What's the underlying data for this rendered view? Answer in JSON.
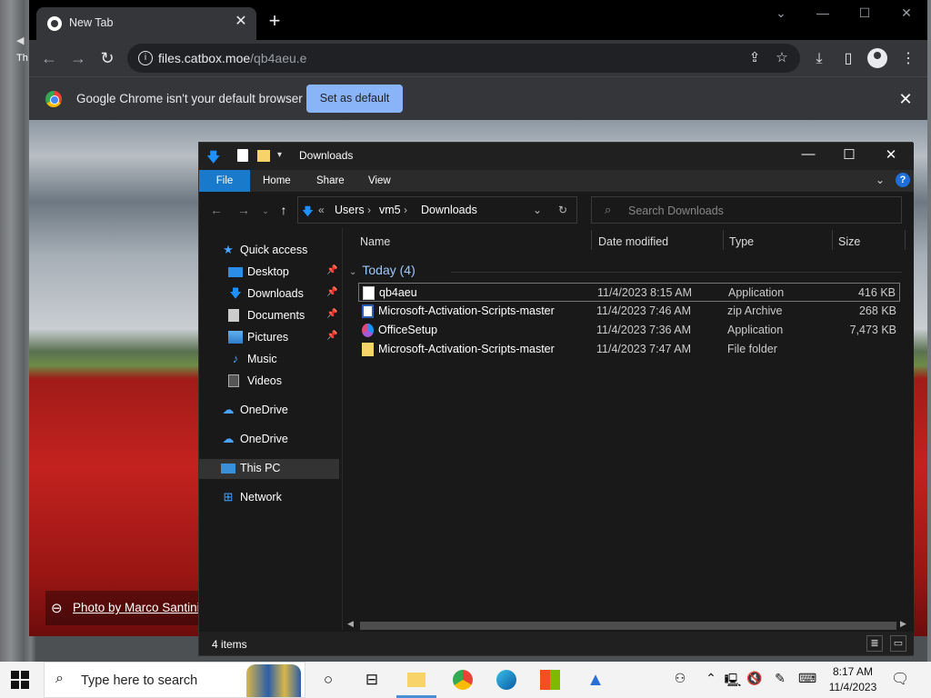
{
  "browser": {
    "tab_title": "New Tab",
    "url_host": "files.catbox.moe",
    "url_path": "/qb4aeu.e",
    "infobar_text": "Google Chrome isn't your default browser",
    "infobar_button": "Set as default",
    "photo_credit": "Photo by Marco Santini",
    "desktop_text": "Th"
  },
  "explorer": {
    "title": "Downloads",
    "ribbon": {
      "file": "File",
      "home": "Home",
      "share": "Share",
      "view": "View"
    },
    "breadcrumb": [
      "Users",
      "vm5",
      "Downloads"
    ],
    "search_placeholder": "Search Downloads",
    "nav": [
      {
        "label": "Quick access",
        "icon": "star-icon"
      },
      {
        "label": "Desktop",
        "icon": "desktop-icon",
        "pinned": true
      },
      {
        "label": "Downloads",
        "icon": "download-arrow-icon",
        "pinned": true
      },
      {
        "label": "Documents",
        "icon": "documents-icon",
        "pinned": true
      },
      {
        "label": "Pictures",
        "icon": "pictures-icon",
        "pinned": true
      },
      {
        "label": "Music",
        "icon": "music-icon"
      },
      {
        "label": "Videos",
        "icon": "videos-icon"
      },
      {
        "label": "OneDrive",
        "icon": "cloud-icon"
      },
      {
        "label": "OneDrive",
        "icon": "cloud-icon"
      },
      {
        "label": "This PC",
        "icon": "computer-icon",
        "selected": true
      },
      {
        "label": "Network",
        "icon": "network-icon"
      }
    ],
    "columns": {
      "name": "Name",
      "date": "Date modified",
      "type": "Type",
      "size": "Size"
    },
    "group": "Today (4)",
    "files": [
      {
        "name": "qb4aeu",
        "date": "11/4/2023 8:15 AM",
        "type": "Application",
        "size": "416 KB",
        "icon": "application-icon",
        "selected": true
      },
      {
        "name": "Microsoft-Activation-Scripts-master",
        "date": "11/4/2023 7:46 AM",
        "type": "zip Archive",
        "size": "268 KB",
        "icon": "zip-icon"
      },
      {
        "name": "OfficeSetup",
        "date": "11/4/2023 7:36 AM",
        "type": "Application",
        "size": "7,473 KB",
        "icon": "office-icon"
      },
      {
        "name": "Microsoft-Activation-Scripts-master",
        "date": "11/4/2023 7:47 AM",
        "type": "File folder",
        "size": "",
        "icon": "folder-icon"
      }
    ],
    "status": "4 items"
  },
  "taskbar": {
    "search_placeholder": "Type here to search",
    "time": "8:17 AM",
    "date": "11/4/2023"
  },
  "colors": {
    "explorer_accent": "#1979ca",
    "chrome_button": "#8ab4f8"
  }
}
